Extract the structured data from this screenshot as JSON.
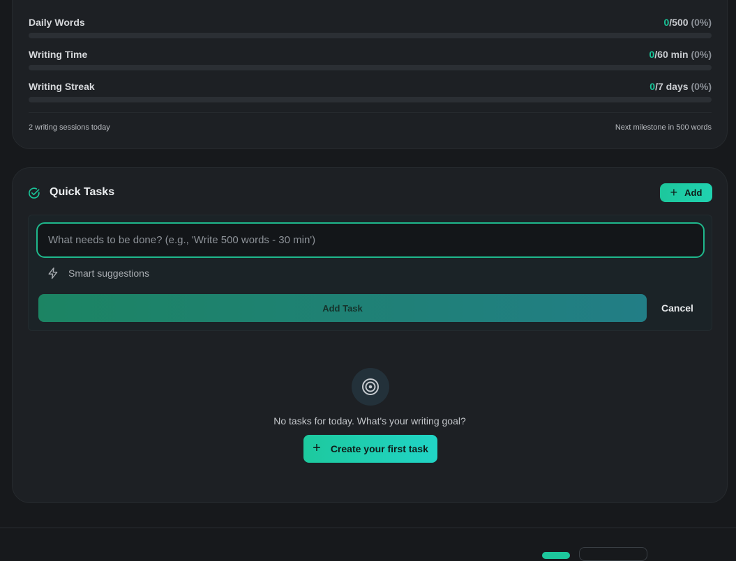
{
  "goals": {
    "items": [
      {
        "label": "Daily Words",
        "current": "0",
        "target": "/500",
        "percent": "(0%)",
        "progress": 0
      },
      {
        "label": "Writing Time",
        "current": "0",
        "target": "/60 min",
        "percent": "(0%)",
        "progress": 0
      },
      {
        "label": "Writing Streak",
        "current": "0",
        "target": "/7 days",
        "percent": "(0%)",
        "progress": 0
      }
    ],
    "footer_left": "2 writing sessions today",
    "footer_right": "Next milestone in 500 words"
  },
  "tasks": {
    "title": "Quick Tasks",
    "add_label": "Add",
    "input": {
      "value": "",
      "placeholder": "What needs to be done? (e.g., 'Write 500 words - 30 min')"
    },
    "smart_suggestions_label": "Smart suggestions",
    "add_task_label": "Add Task",
    "cancel_label": "Cancel",
    "empty_text": "No tasks for today. What's your writing goal?",
    "create_first_label": "Create your first task",
    "icons": [
      "check-circle-icon",
      "plus-icon",
      "lightning-icon",
      "target-icon"
    ]
  },
  "colors": {
    "accent": "#19c79a",
    "background": "#17191c",
    "card": "#1d2024"
  }
}
